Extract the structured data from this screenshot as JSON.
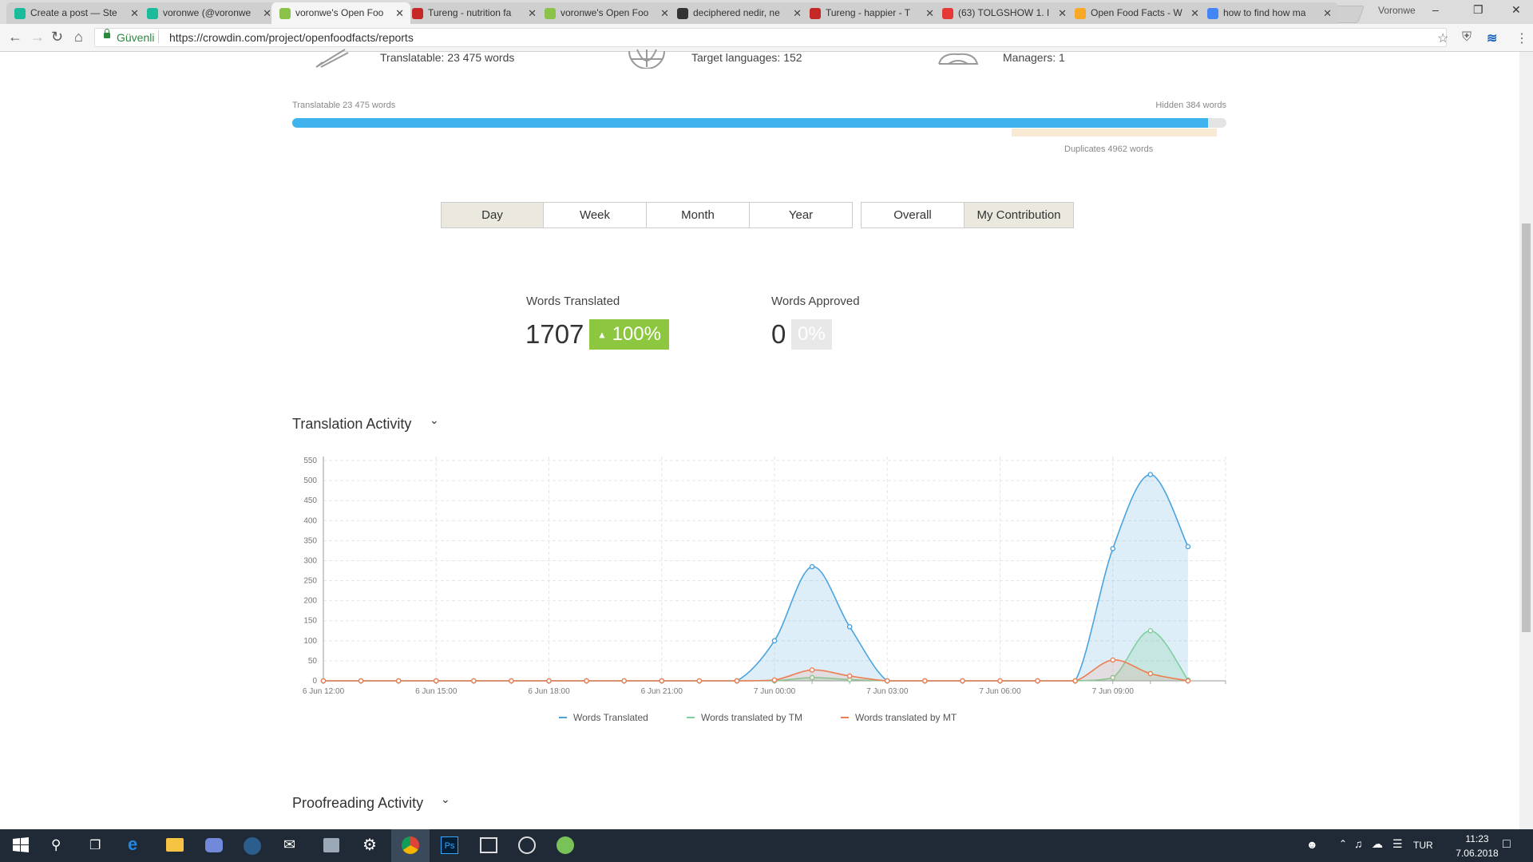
{
  "browser": {
    "tabs": [
      {
        "label": "Create a post — Ste",
        "favicon_color": "#1abc9c",
        "active": false
      },
      {
        "label": "voronwe (@voronwe",
        "favicon_color": "#1abc9c",
        "active": false
      },
      {
        "label": "voronwe's Open Foo",
        "favicon_color": "#8bc34a",
        "active": true
      },
      {
        "label": "Tureng - nutrition fa",
        "favicon_color": "#c62828",
        "active": false
      },
      {
        "label": "voronwe's Open Foo",
        "favicon_color": "#8bc34a",
        "active": false
      },
      {
        "label": "deciphered nedir, ne",
        "favicon_color": "#333333",
        "active": false
      },
      {
        "label": "Tureng - happier - T",
        "favicon_color": "#c62828",
        "active": false
      },
      {
        "label": "(63) TOLGSHOW 1. I",
        "favicon_color": "#e53935",
        "active": false
      },
      {
        "label": "Open Food Facts - W",
        "favicon_color": "#f9a825",
        "active": false
      },
      {
        "label": "how to find how ma",
        "favicon_color": "#4285f4",
        "active": false
      }
    ],
    "profile_name": "Voronwe",
    "secure_label": "Güvenli",
    "url": "https://crowdin.com/project/openfoodfacts/reports",
    "window_controls": [
      "minimize-icon",
      "restore-icon",
      "close-icon"
    ]
  },
  "stats": {
    "translatable": "Translatable: 23 475 words",
    "target_languages": "Target languages: 152",
    "managers": "Managers: 1",
    "translatable_short": "Translatable 23 475 words",
    "hidden": "Hidden 384 words",
    "duplicates": "Duplicates 4962 words",
    "translatable_fraction": 0.98,
    "duplicates_start_fraction": 0.77,
    "duplicates_end_fraction": 0.99,
    "bar_color": "#3eb3ee"
  },
  "periods": {
    "day": "Day",
    "week": "Week",
    "month": "Month",
    "year": "Year",
    "overall": "Overall",
    "my_contribution": "My Contribution",
    "selected": [
      "Day",
      "My Contribution"
    ]
  },
  "kpis": {
    "words_translated_label": "Words Translated",
    "words_translated_value": "1707",
    "words_translated_change": "100%",
    "words_approved_label": "Words Approved",
    "words_approved_value": "0",
    "words_approved_change": "0%",
    "positive_color": "#8dc63f"
  },
  "sections": {
    "translation_activity": "Translation Activity",
    "proofreading_activity": "Proofreading Activity"
  },
  "chart_data": {
    "type": "area",
    "x_ticks": [
      "6 Jun 12:00",
      "6 Jun 15:00",
      "6 Jun 18:00",
      "6 Jun 21:00",
      "7 Jun 00:00",
      "7 Jun 03:00",
      "7 Jun 06:00",
      "7 Jun 09:00"
    ],
    "x_hours": [
      0,
      1,
      2,
      3,
      4,
      5,
      6,
      7,
      8,
      9,
      10,
      11,
      12,
      13,
      14,
      15,
      16,
      17,
      18,
      19,
      20,
      21,
      22,
      23,
      24
    ],
    "y_ticks": [
      0,
      50,
      100,
      150,
      200,
      250,
      300,
      350,
      400,
      450,
      500,
      550
    ],
    "ylim": [
      0,
      560
    ],
    "grid": true,
    "legend_position": "bottom-center",
    "series": [
      {
        "name": "Words Translated",
        "color": "#4aa3df",
        "values": [
          0,
          0,
          0,
          0,
          0,
          0,
          0,
          0,
          0,
          0,
          0,
          0,
          100,
          285,
          135,
          0,
          0,
          0,
          0,
          0,
          0,
          330,
          515,
          335,
          null
        ]
      },
      {
        "name": "Words translated by TM",
        "color": "#7fcf9f",
        "values": [
          0,
          0,
          0,
          0,
          0,
          0,
          0,
          0,
          0,
          0,
          0,
          0,
          0,
          8,
          3,
          0,
          0,
          0,
          0,
          0,
          0,
          8,
          125,
          2,
          null
        ]
      },
      {
        "name": "Words translated by MT",
        "color": "#ef7d52",
        "values": [
          0,
          0,
          0,
          0,
          0,
          0,
          0,
          0,
          0,
          0,
          0,
          0,
          2,
          27,
          12,
          0,
          0,
          0,
          0,
          0,
          0,
          52,
          18,
          0,
          null
        ]
      }
    ]
  },
  "taskbar": {
    "language": "TUR",
    "time": "11:23",
    "date": "7.06.2018"
  }
}
